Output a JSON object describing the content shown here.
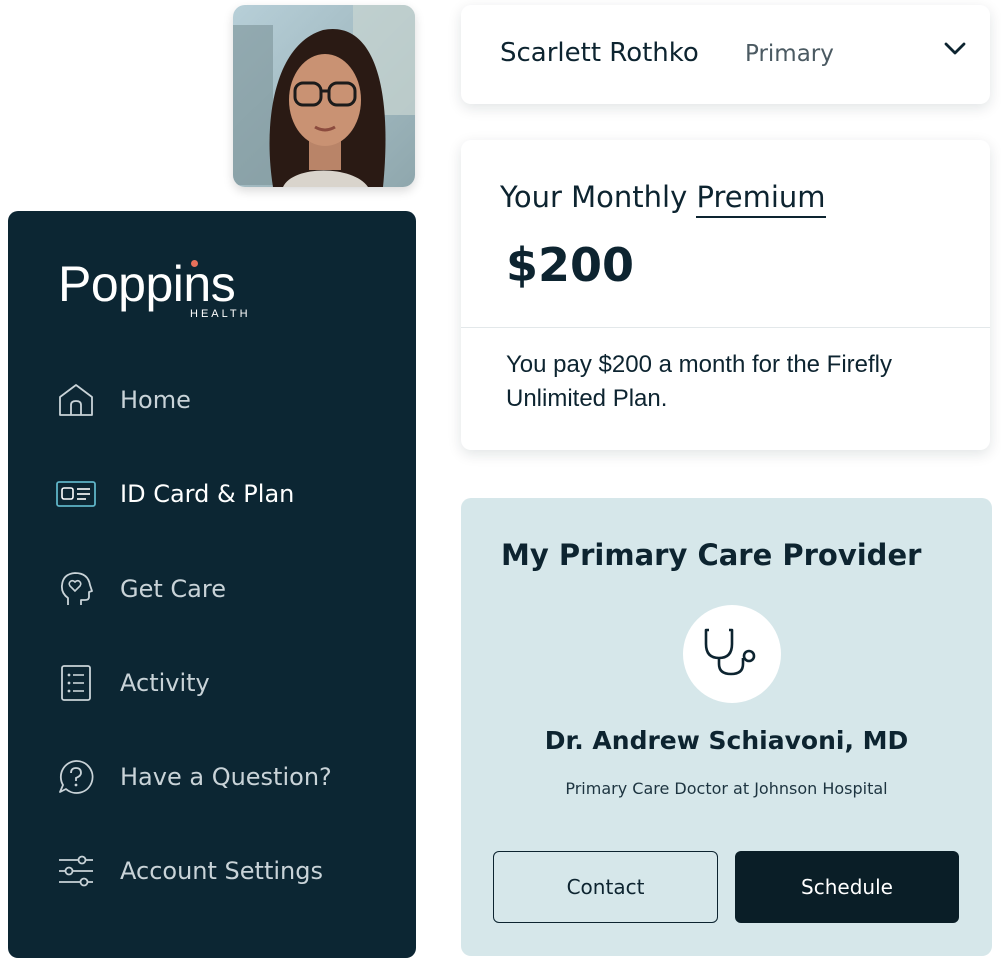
{
  "user": {
    "photo_alt": "Profile photo",
    "name": "Scarlett Rothko",
    "role": "Primary"
  },
  "brand": {
    "name": "Poppins",
    "subtitle": "HEALTH",
    "accent_color": "#e8705b"
  },
  "sidebar": {
    "items": [
      {
        "label": "Home",
        "icon": "home-icon"
      },
      {
        "label": "ID Card & Plan",
        "icon": "id-card-icon",
        "active": true
      },
      {
        "label": "Get Care",
        "icon": "head-heart-icon"
      },
      {
        "label": "Activity",
        "icon": "list-icon"
      },
      {
        "label": "Have a Question?",
        "icon": "question-bubble-icon"
      },
      {
        "label": "Account Settings",
        "icon": "sliders-icon"
      }
    ]
  },
  "premium": {
    "title_prefix": "Your Monthly ",
    "title_link": "Premium",
    "amount": "$200",
    "description": "You pay $200 a month for the Firefly Unlimited Plan."
  },
  "provider": {
    "heading": "My Primary Care Provider",
    "icon": "stethoscope-icon",
    "doctor_name": "Dr. Andrew Schiavoni, MD",
    "doctor_role": "Primary Care Doctor at Johnson Hospital",
    "contact_label": "Contact",
    "schedule_label": "Schedule"
  },
  "colors": {
    "sidebar_bg": "#0c2633",
    "provider_bg": "#d6e7ea",
    "primary_dark": "#0a1e27"
  }
}
